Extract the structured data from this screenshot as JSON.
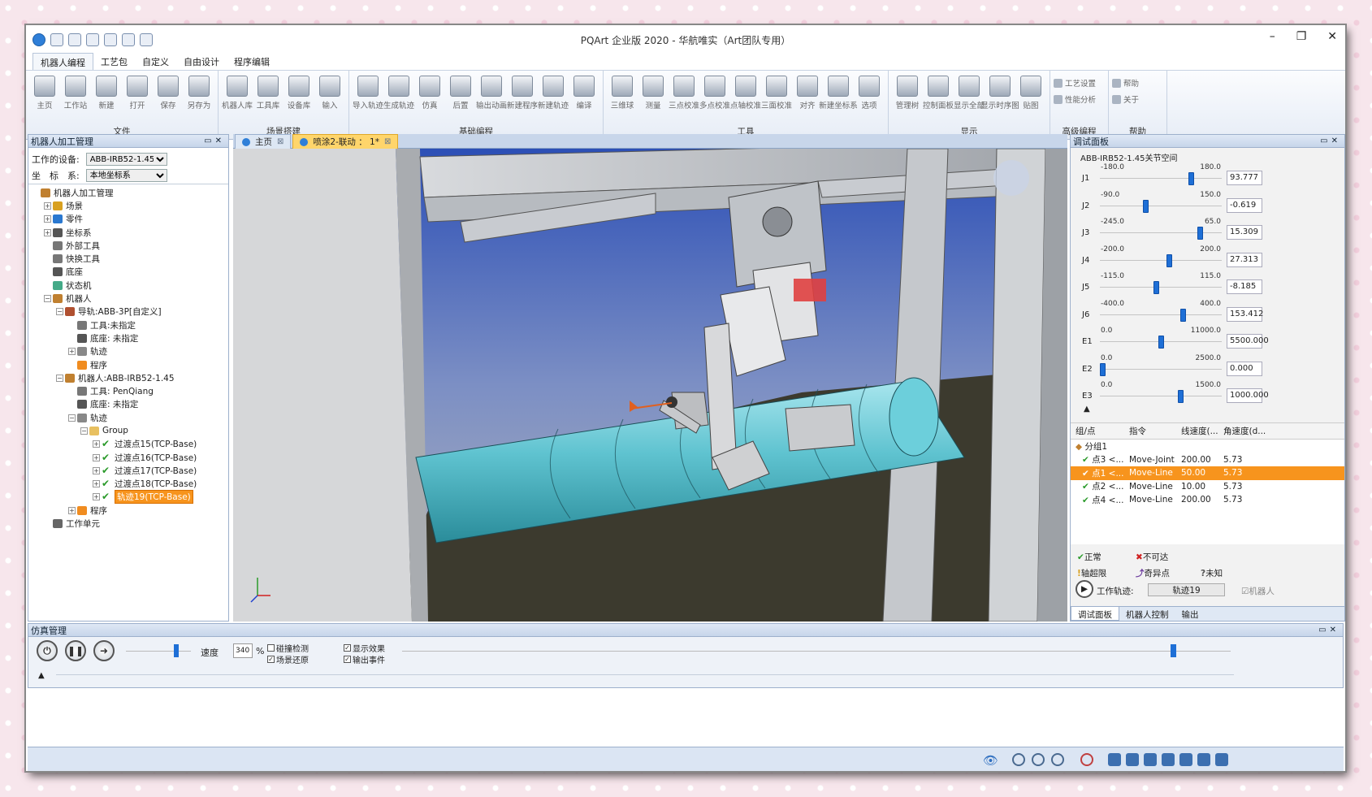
{
  "window": {
    "title": "PQArt 企业版 2020 - 华航唯实（Art团队专用）"
  },
  "menu_tabs": [
    "机器人编程",
    "工艺包",
    "自定义",
    "自由设计",
    "程序编辑"
  ],
  "ribbon": {
    "groups": [
      {
        "name": "文件",
        "buttons": [
          "主页",
          "工作站",
          "新建",
          "打开",
          "保存",
          "另存为"
        ]
      },
      {
        "name": "场景搭建",
        "buttons": [
          "机器人库",
          "工具库",
          "设备库",
          "输入"
        ]
      },
      {
        "name": "基础编程",
        "buttons": [
          "导入轨迹",
          "生成轨迹",
          "仿真",
          "后置",
          "输出动画",
          "新建程序",
          "新建轨迹",
          "编译"
        ]
      },
      {
        "name": "工具",
        "buttons": [
          "三维球",
          "测量",
          "三点校准",
          "多点校准",
          "点轴校准",
          "三面校准",
          "对齐",
          "新建坐标系",
          "选项"
        ]
      },
      {
        "name": "显示",
        "buttons": [
          "管理树",
          "控制面板",
          "显示全部",
          "显示时序图",
          "贴图"
        ]
      },
      {
        "name": "高级编程",
        "small": [
          "工艺设置",
          "性能分析"
        ]
      },
      {
        "name": "帮助",
        "small": [
          "帮助",
          "关于"
        ]
      }
    ]
  },
  "left_panel": {
    "title": "机器人加工管理",
    "device_label": "工作的设备:",
    "device_value": "ABB-IRB52-1.45",
    "coord_label": "坐　标　系:",
    "coord_value": "本地坐标系",
    "tree": [
      {
        "level": 0,
        "exp": "",
        "label": "机器人加工管理",
        "icon": "robot-icon",
        "color": "#c08030"
      },
      {
        "level": 1,
        "exp": "+",
        "label": "场景",
        "icon": "scene-icon",
        "color": "#d8a020"
      },
      {
        "level": 1,
        "exp": "+",
        "label": "零件",
        "icon": "part-icon",
        "color": "#2a78d0"
      },
      {
        "level": 1,
        "exp": "+",
        "label": "坐标系",
        "icon": "axis-icon",
        "color": "#555"
      },
      {
        "level": 1,
        "exp": "",
        "label": "外部工具",
        "icon": "tool-icon",
        "color": "#777"
      },
      {
        "level": 1,
        "exp": "",
        "label": "快换工具",
        "icon": "tool-icon",
        "color": "#777"
      },
      {
        "level": 1,
        "exp": "",
        "label": "底座",
        "icon": "base-icon",
        "color": "#555"
      },
      {
        "level": 1,
        "exp": "",
        "label": "状态机",
        "icon": "state-icon",
        "color": "#4a8"
      },
      {
        "level": 1,
        "exp": "-",
        "label": "机器人",
        "icon": "robot-icon",
        "color": "#c08030"
      },
      {
        "level": 2,
        "exp": "-",
        "label": "导轨:ABB-3P[自定义]",
        "icon": "rail-icon",
        "color": "#b05030"
      },
      {
        "level": 3,
        "exp": "",
        "label": "工具:未指定",
        "icon": "tool-icon",
        "color": "#777"
      },
      {
        "level": 3,
        "exp": "",
        "label": "底座: 未指定",
        "icon": "base-icon",
        "color": "#555"
      },
      {
        "level": 3,
        "exp": "+",
        "label": "轨迹",
        "icon": "path-icon",
        "color": "#888"
      },
      {
        "level": 3,
        "exp": "",
        "label": "程序",
        "icon": "program-icon",
        "color": "#f08c20"
      },
      {
        "level": 2,
        "exp": "-",
        "label": "机器人:ABB-IRB52-1.45",
        "icon": "robot-icon",
        "color": "#c08030"
      },
      {
        "level": 3,
        "exp": "",
        "label": "工具: PenQiang",
        "icon": "tool-icon",
        "color": "#777"
      },
      {
        "level": 3,
        "exp": "",
        "label": "底座: 未指定",
        "icon": "base-icon",
        "color": "#555"
      },
      {
        "level": 3,
        "exp": "-",
        "label": "轨迹",
        "icon": "path-icon",
        "color": "#888"
      },
      {
        "level": 4,
        "exp": "-",
        "label": "Group",
        "icon": "folder-icon",
        "color": "#e8c060"
      },
      {
        "level": 5,
        "exp": "+",
        "label": "过渡点15(TCP-Base)",
        "icon": "ok-icon",
        "color": ""
      },
      {
        "level": 5,
        "exp": "+",
        "label": "过渡点16(TCP-Base)",
        "icon": "ok-icon",
        "color": ""
      },
      {
        "level": 5,
        "exp": "+",
        "label": "过渡点17(TCP-Base)",
        "icon": "ok-icon",
        "color": ""
      },
      {
        "level": 5,
        "exp": "+",
        "label": "过渡点18(TCP-Base)",
        "icon": "ok-icon",
        "color": ""
      },
      {
        "level": 5,
        "exp": "+",
        "label": "轨迹19(TCP-Base)",
        "icon": "ok-icon",
        "color": "",
        "selected": true
      },
      {
        "level": 3,
        "exp": "+",
        "label": "程序",
        "icon": "program-icon",
        "color": "#f08c20"
      },
      {
        "level": 1,
        "exp": "",
        "label": "工作单元",
        "icon": "cell-icon",
        "color": "#666"
      }
    ]
  },
  "view_tabs": [
    {
      "label": "主页",
      "active": false
    },
    {
      "label": "喷涂2-联动 ： 1*",
      "active": true
    }
  ],
  "debug_panel": {
    "title": "调试面板",
    "joint_space_label": "ABB-IRB52-1.45关节空间",
    "joints": [
      {
        "name": "J1",
        "min": "-180.0",
        "max": "180.0",
        "value": "93.777",
        "level": 0.76
      },
      {
        "name": "J2",
        "min": "-90.0",
        "max": "150.0",
        "value": "-0.619",
        "level": 0.37
      },
      {
        "name": "J3",
        "min": "-245.0",
        "max": "65.0",
        "value": "15.309",
        "level": 0.84
      },
      {
        "name": "J4",
        "min": "-200.0",
        "max": "200.0",
        "value": "27.313",
        "level": 0.57
      },
      {
        "name": "J5",
        "min": "-115.0",
        "max": "115.0",
        "value": "-8.185",
        "level": 0.46
      },
      {
        "name": "J6",
        "min": "-400.0",
        "max": "400.0",
        "value": "153.412",
        "level": 0.69
      },
      {
        "name": "E1",
        "min": "0.0",
        "max": "11000.0",
        "value": "5500.000",
        "level": 0.5
      },
      {
        "name": "E2",
        "min": "0.0",
        "max": "2500.0",
        "value": "0.000",
        "level": 0.0
      },
      {
        "name": "E3",
        "min": "0.0",
        "max": "1500.0",
        "value": "1000.000",
        "level": 0.67
      }
    ],
    "table_headers": [
      "组/点",
      "指令",
      "线速度(...",
      "角速度(d..."
    ],
    "group_label": "分组1",
    "rows": [
      {
        "point": "点3 <...",
        "cmd": "Move-Joint",
        "speed": "200.00",
        "ang": "5.73",
        "selected": false
      },
      {
        "point": "点1 <...",
        "cmd": "Move-Line",
        "speed": "50.00",
        "ang": "5.73",
        "selected": true
      },
      {
        "point": "点2 <...",
        "cmd": "Move-Line",
        "speed": "10.00",
        "ang": "5.73",
        "selected": false
      },
      {
        "point": "点4 <...",
        "cmd": "Move-Line",
        "speed": "200.00",
        "ang": "5.73",
        "selected": false
      }
    ],
    "legend": {
      "normal": "正常",
      "unreachable": "不可达",
      "axis_limit": "轴超限",
      "singular": "奇异点",
      "unknown": "未知"
    },
    "work_path_label": "工作轨迹:",
    "work_path_value": "轨迹19",
    "robot_check_label": "机器人",
    "bottom_tabs": [
      "调试面板",
      "机器人控制",
      "输出"
    ]
  },
  "sim_panel": {
    "title": "仿真管理",
    "speed_label": "速度",
    "speed_value": "340",
    "speed_unit": "%",
    "speed_level": 0.78,
    "timeline_level": 0.93,
    "checks": [
      {
        "label": "碰撞检测",
        "checked": false
      },
      {
        "label": "场景还原",
        "checked": true
      },
      {
        "label": "显示效果",
        "checked": true
      },
      {
        "label": "输出事件",
        "checked": true
      }
    ]
  },
  "colors": {
    "accent": "#f7941d",
    "slider": "#1e6fd6",
    "pipe": "#5fc3d0"
  }
}
